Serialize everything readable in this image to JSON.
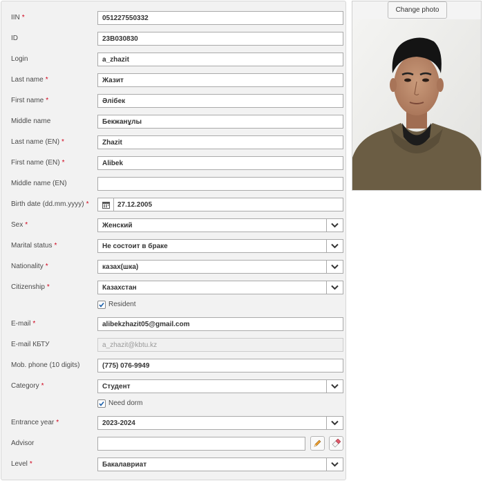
{
  "form": {
    "iin": {
      "label": "IIN",
      "required": true,
      "value": "051227550332"
    },
    "id": {
      "label": "ID",
      "required": false,
      "value": "23B030830"
    },
    "login": {
      "label": "Login",
      "required": false,
      "value": "a_zhazit"
    },
    "last_name": {
      "label": "Last name",
      "required": true,
      "value": "Жазит"
    },
    "first_name": {
      "label": "First name",
      "required": true,
      "value": "Әлібек"
    },
    "middle_name": {
      "label": "Middle name",
      "required": false,
      "value": "Бекжанұлы"
    },
    "last_name_en": {
      "label": "Last name (EN)",
      "required": true,
      "value": "Zhazit"
    },
    "first_name_en": {
      "label": "First name (EN)",
      "required": true,
      "value": "Alibek"
    },
    "middle_name_en": {
      "label": "Middle name (EN)",
      "required": false,
      "value": ""
    },
    "birth_date": {
      "label": "Birth date (dd.mm.yyyy)",
      "required": true,
      "value": "27.12.2005"
    },
    "sex": {
      "label": "Sex",
      "required": true,
      "value": "Женский"
    },
    "marital_status": {
      "label": "Marital status",
      "required": true,
      "value": "Не состоит в браке"
    },
    "nationality": {
      "label": "Nationality",
      "required": true,
      "value": "казах(шка)"
    },
    "citizenship": {
      "label": "Citizenship",
      "required": true,
      "value": "Казахстан"
    },
    "resident": {
      "label": "Resident",
      "checked": true
    },
    "email": {
      "label": "E-mail",
      "required": true,
      "value": "alibekzhazit05@gmail.com"
    },
    "email_kbtu": {
      "label": "E-mail КБТУ",
      "required": false,
      "value": "a_zhazit@kbtu.kz"
    },
    "mob_phone": {
      "label": "Mob. phone (10 digits)",
      "required": false,
      "value": "(775) 076-9949"
    },
    "category": {
      "label": "Category",
      "required": true,
      "value": "Студент"
    },
    "need_dorm": {
      "label": "Need dorm",
      "checked": true
    },
    "entrance_year": {
      "label": "Entrance year",
      "required": true,
      "value": "2023-2024"
    },
    "advisor": {
      "label": "Advisor",
      "required": false,
      "value": ""
    },
    "level": {
      "label": "Level",
      "required": true,
      "value": "Бакалавриат"
    }
  },
  "photo_panel": {
    "change_photo_label": "Change photo"
  },
  "colors": {
    "required_mark": "#d0021b",
    "panel_bg": "#f2f2f2",
    "field_border": "#a9a9a9"
  },
  "icons": {
    "select_arrow": "chevron-down-icon",
    "calendar": "calendar-icon",
    "edit": "pencil-icon",
    "clear": "eraser-icon",
    "check": "checkmark-icon"
  }
}
